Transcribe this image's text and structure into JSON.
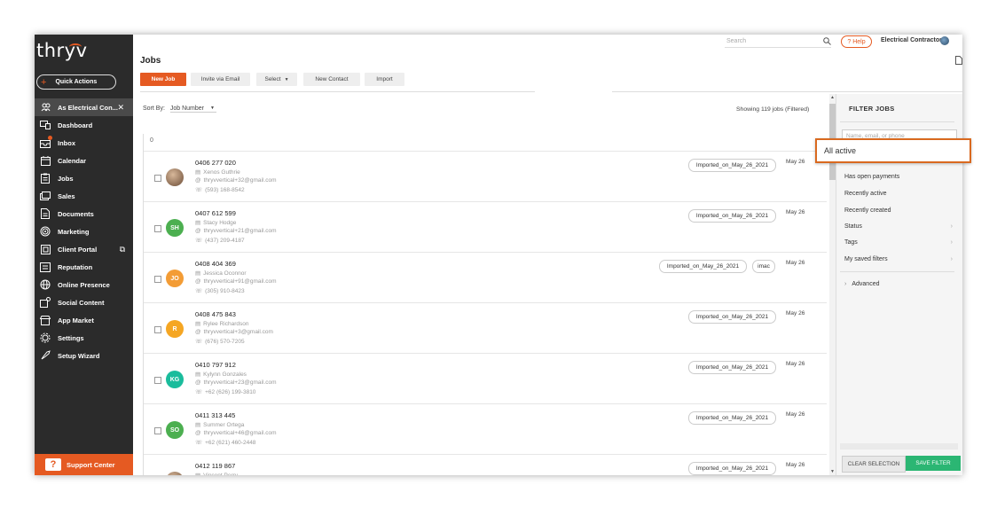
{
  "app": {
    "logo": "thryv",
    "quick_actions": "Quick Actions"
  },
  "sidebar": {
    "items": [
      {
        "label": "As Electrical Con...",
        "icon": "people-icon"
      },
      {
        "label": "Dashboard",
        "icon": "dashboard-icon"
      },
      {
        "label": "Inbox",
        "icon": "inbox-icon"
      },
      {
        "label": "Calendar",
        "icon": "calendar-icon"
      },
      {
        "label": "Jobs",
        "icon": "clipboard-icon"
      },
      {
        "label": "Sales",
        "icon": "sales-icon"
      },
      {
        "label": "Documents",
        "icon": "document-icon"
      },
      {
        "label": "Marketing",
        "icon": "target-icon"
      },
      {
        "label": "Client Portal",
        "icon": "portal-icon"
      },
      {
        "label": "Reputation",
        "icon": "reputation-icon"
      },
      {
        "label": "Online Presence",
        "icon": "globe-icon"
      },
      {
        "label": "Social Content",
        "icon": "social-icon"
      },
      {
        "label": "App Market",
        "icon": "store-icon"
      },
      {
        "label": "Settings",
        "icon": "gear-icon"
      },
      {
        "label": "Setup Wizard",
        "icon": "rocket-icon"
      }
    ],
    "support_center": "Support Center"
  },
  "topbar": {
    "search_placeholder": "Search",
    "help": "? Help",
    "company": "Electrical Contractor ..."
  },
  "page": {
    "title": "Jobs"
  },
  "toolbar": {
    "new_job": "New Job",
    "invite": "Invite via Email",
    "select": "Select",
    "new_contact": "New Contact",
    "import": "Import"
  },
  "list": {
    "sort_label": "Sort By:",
    "sort_value": "Job Number",
    "showing": "Showing 119 jobs (Filtered)",
    "group_header": "0",
    "rows": [
      {
        "number": "0406 277 020",
        "name": "Xenos Guthrie",
        "email": "thryvvertical+32@gmail.com",
        "phone": "(593) 168-8542",
        "initials": "",
        "color": "#8a6a4f",
        "tags": [
          "Imported_on_May_26_2021"
        ],
        "date": "May 26"
      },
      {
        "number": "0407 612 599",
        "name": "Stacy Hodge",
        "email": "thryvvertical+21@gmail.com",
        "phone": "(437) 209-4187",
        "initials": "SH",
        "color": "#4caf50",
        "tags": [
          "Imported_on_May_26_2021"
        ],
        "date": "May 26"
      },
      {
        "number": "0408 404 369",
        "name": "Jessica Oconnor",
        "email": "thryvvertical+91@gmail.com",
        "phone": "(305) 910-8423",
        "initials": "JO",
        "color": "#f39c35",
        "tags": [
          "Imported_on_May_26_2021",
          "imac"
        ],
        "date": "May 26"
      },
      {
        "number": "0408 475 843",
        "name": "Rylee Richardson",
        "email": "thryvvertical+3@gmail.com",
        "phone": "(676) 570-7205",
        "initials": "R",
        "color": "#f5a623",
        "tags": [
          "Imported_on_May_26_2021"
        ],
        "date": "May 26"
      },
      {
        "number": "0410 797 912",
        "name": "Kylynn Gonzales",
        "email": "thryvvertical+23@gmail.com",
        "phone": "+62 (626) 199-3810",
        "initials": "KG",
        "color": "#1abc9c",
        "tags": [
          "Imported_on_May_26_2021"
        ],
        "date": "May 26"
      },
      {
        "number": "0411 313 445",
        "name": "Summer Ortega",
        "email": "thryvvertical+46@gmail.com",
        "phone": "+62 (621) 460-2448",
        "initials": "SO",
        "color": "#4caf50",
        "tags": [
          "Imported_on_May_26_2021"
        ],
        "date": "May 26"
      },
      {
        "number": "0412 119 867",
        "name": "Vincent Perry",
        "email": "",
        "phone": "",
        "initials": "",
        "color": "#1abc9c",
        "tags": [
          "Imported_on_May_26_2021"
        ],
        "date": "May 26"
      }
    ]
  },
  "filter": {
    "title": "FILTER JOBS",
    "search_placeholder": "Name, email, or phone",
    "items": [
      "Has open payments",
      "Recently active",
      "Recently created",
      "Status",
      "Tags",
      "My saved filters"
    ],
    "advanced": "Advanced",
    "clear": "CLEAR SELECTION",
    "save": "SAVE FILTER"
  },
  "callout": {
    "label": "All active"
  }
}
